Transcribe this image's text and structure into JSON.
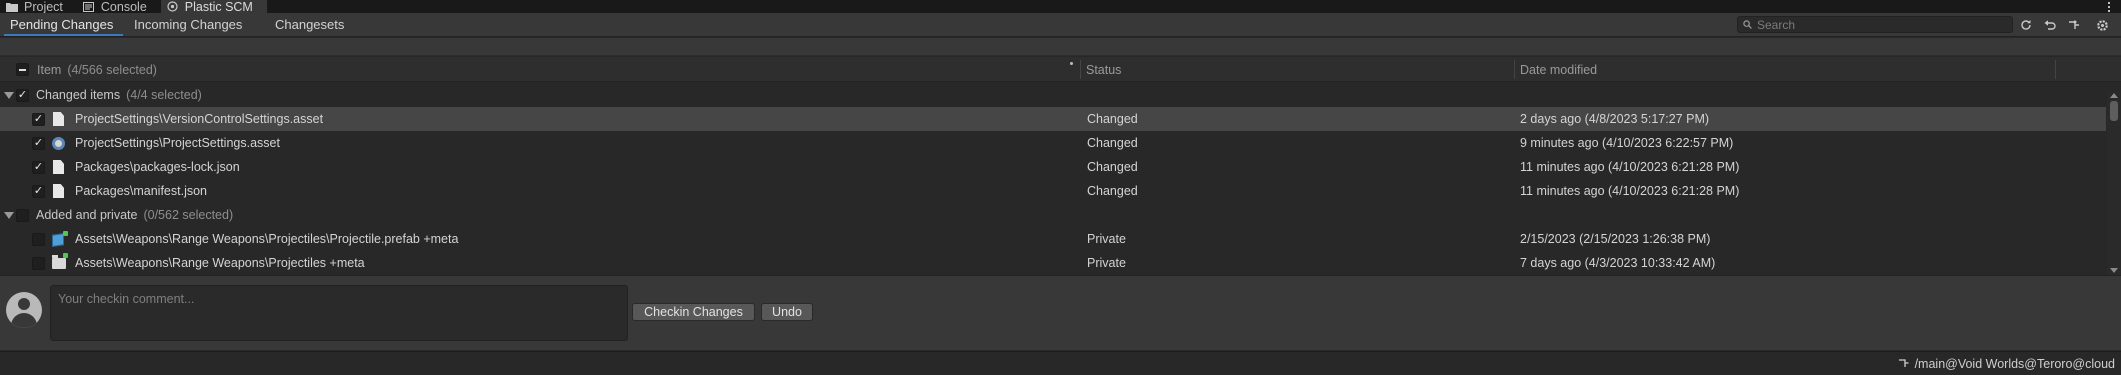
{
  "window_tabs": [
    {
      "label": "Project",
      "icon": "folder-icon",
      "active": false
    },
    {
      "label": "Console",
      "icon": "console-icon",
      "active": false
    },
    {
      "label": "Plastic SCM",
      "icon": "plastic-scm-icon",
      "active": true
    }
  ],
  "subtabs": [
    {
      "label": "Pending Changes",
      "active": true
    },
    {
      "label": "Incoming Changes",
      "active": false
    },
    {
      "label": "Changesets",
      "active": false
    }
  ],
  "search": {
    "placeholder": "Search"
  },
  "toolbar_icons": [
    "refresh-icon",
    "undo-icon",
    "branch-icon",
    "settings-icon"
  ],
  "table": {
    "columns": {
      "item": "Item",
      "item_count": "(4/566 selected)",
      "status": "Status",
      "date": "Date modified"
    },
    "groups": [
      {
        "label": "Changed items",
        "count": "(4/4 selected)",
        "checked": true,
        "items": [
          {
            "path": "ProjectSettings\\VersionControlSettings.asset",
            "status": "Changed",
            "date": "2 days ago (4/8/2023 5:17:27 PM)",
            "icon": "file-icon",
            "checked": true,
            "selected": true
          },
          {
            "path": "ProjectSettings\\ProjectSettings.asset",
            "status": "Changed",
            "date": "9 minutes ago (4/10/2023 6:22:57 PM)",
            "icon": "settings-asset-icon",
            "checked": true,
            "selected": false
          },
          {
            "path": "Packages\\packages-lock.json",
            "status": "Changed",
            "date": "11 minutes ago (4/10/2023 6:21:28 PM)",
            "icon": "file-icon",
            "checked": true,
            "selected": false
          },
          {
            "path": "Packages\\manifest.json",
            "status": "Changed",
            "date": "11 minutes ago (4/10/2023 6:21:28 PM)",
            "icon": "file-icon",
            "checked": true,
            "selected": false
          }
        ]
      },
      {
        "label": "Added and private",
        "count": "(0/562 selected)",
        "checked": false,
        "items": [
          {
            "path": "Assets\\Weapons\\Range Weapons\\Projectiles\\Projectile.prefab +meta",
            "status": "Private",
            "date": "2/15/2023 (2/15/2023 1:26:38 PM)",
            "icon": "prefab-icon",
            "checked": false,
            "selected": false
          },
          {
            "path": "Assets\\Weapons\\Range Weapons\\Projectiles +meta",
            "status": "Private",
            "date": "7 days ago (4/3/2023 10:33:42 AM)",
            "icon": "folder-icon",
            "checked": false,
            "selected": false
          }
        ]
      }
    ]
  },
  "comment": {
    "placeholder": "Your checkin comment..."
  },
  "buttons": {
    "checkin": "Checkin Changes",
    "undo": "Undo"
  },
  "status_bar": {
    "branch": "/main@Void Worlds@Teroro@cloud"
  },
  "colors": {
    "accent": "#3a79bb",
    "selected_row": "#464646",
    "panel": "#383838",
    "background": "#282828"
  }
}
